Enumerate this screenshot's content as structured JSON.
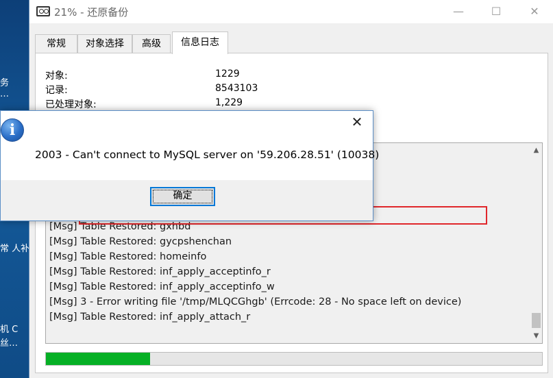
{
  "desktop": {
    "items": [
      "务",
      "…",
      "常 人补",
      "机 C",
      "丝…"
    ]
  },
  "window": {
    "title": "21% - 还原备份",
    "controls": {
      "minimize": "—",
      "maximize": "☐",
      "close": "✕"
    }
  },
  "tabs": [
    {
      "label": "常规"
    },
    {
      "label": "对象选择"
    },
    {
      "label": "高级"
    },
    {
      "label": "信息日志",
      "active": true
    }
  ],
  "stats": [
    {
      "label": "对象:",
      "value": "1229"
    },
    {
      "label": "记录:",
      "value": "8543103"
    },
    {
      "label": "已处理对象:",
      "value": "1,229"
    }
  ],
  "log": {
    "lines": [
      "[Msg] Table Restored: gxhbd",
      "[Msg] Table Restored: gycpshenchan",
      "[Msg] Table Restored: homeinfo",
      "[Msg] Table Restored: inf_apply_acceptinfo_r",
      "[Msg] Table Restored: inf_apply_acceptinfo_w",
      "[Msg] 3 - Error writing file '/tmp/MLQCGhgb' (Errcode: 28 - No space left on device)",
      "[Msg] Table Restored: inf_apply_attach_r"
    ],
    "highlighted_line_index": 5
  },
  "progress": {
    "percent": 21
  },
  "dialog": {
    "message": "2003 - Can't connect to MySQL server on '59.206.28.51' (10038)",
    "ok_label": "确定",
    "close_glyph": "✕",
    "icon_glyph": "i"
  }
}
